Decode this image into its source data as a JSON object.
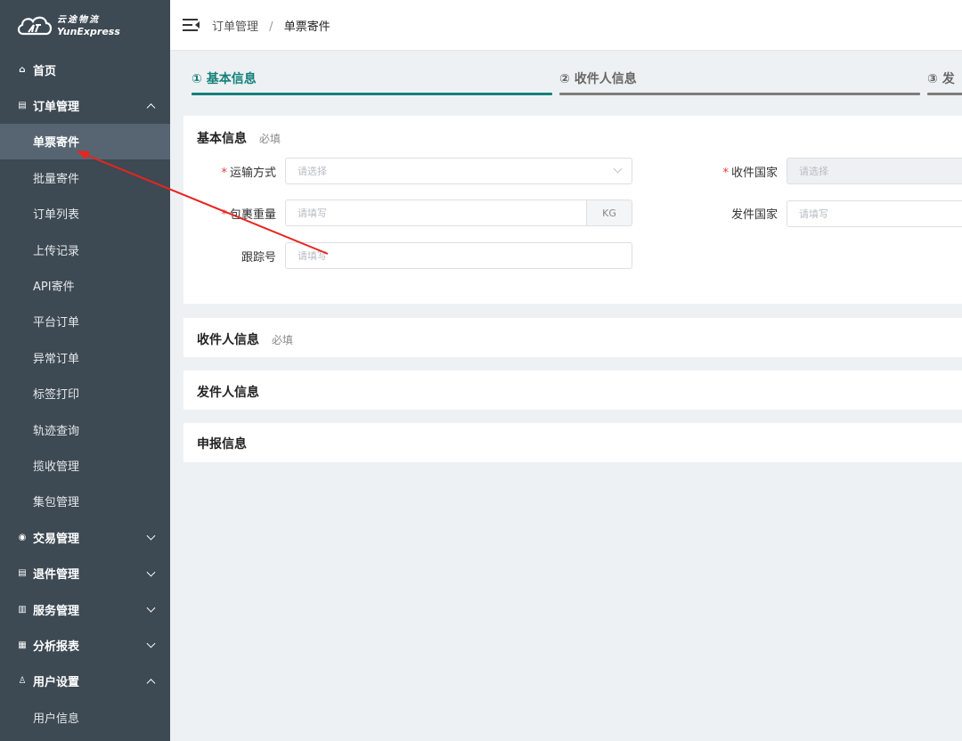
{
  "brand": {
    "cn": "云途物流",
    "en": "YunExpress"
  },
  "sidebar": {
    "items": [
      {
        "label": "首页",
        "level": "top",
        "icon": "home-icon",
        "glyph": "⌂"
      },
      {
        "label": "订单管理",
        "level": "top",
        "icon": "document-icon",
        "glyph": "▤",
        "caret": "up"
      },
      {
        "label": "单票寄件",
        "level": "sub",
        "active": true
      },
      {
        "label": "批量寄件",
        "level": "sub"
      },
      {
        "label": "订单列表",
        "level": "sub"
      },
      {
        "label": "上传记录",
        "level": "sub"
      },
      {
        "label": "API寄件",
        "level": "sub"
      },
      {
        "label": "平台订单",
        "level": "sub"
      },
      {
        "label": "异常订单",
        "level": "sub"
      },
      {
        "label": "标签打印",
        "level": "sub"
      },
      {
        "label": "轨迹查询",
        "level": "sub"
      },
      {
        "label": "揽收管理",
        "level": "sub"
      },
      {
        "label": "集包管理",
        "level": "sub"
      },
      {
        "label": "交易管理",
        "level": "top",
        "icon": "exchange-icon",
        "glyph": "◉",
        "caret": "down"
      },
      {
        "label": "退件管理",
        "level": "top",
        "icon": "document-icon",
        "glyph": "▤",
        "caret": "down"
      },
      {
        "label": "服务管理",
        "level": "top",
        "icon": "service-icon",
        "glyph": "▥",
        "caret": "down"
      },
      {
        "label": "分析报表",
        "level": "top",
        "icon": "chart-icon",
        "glyph": "▦",
        "caret": "down"
      },
      {
        "label": "用户设置",
        "level": "top",
        "icon": "user-icon",
        "glyph": "♙",
        "caret": "up"
      },
      {
        "label": "用户信息",
        "level": "sub"
      }
    ]
  },
  "topbar": {
    "crumb_parent": "订单管理",
    "crumb_sep": "/",
    "crumb_current": "单票寄件"
  },
  "steps": [
    {
      "label": "① 基本信息",
      "active": true
    },
    {
      "label": "② 收件人信息",
      "active": false
    },
    {
      "label": "③ 发",
      "active": false
    }
  ],
  "basic": {
    "title": "基本信息",
    "required": "必填",
    "transport_label": "运输方式",
    "transport_placeholder": "请选择",
    "dest_country_label": "收件国家",
    "dest_country_placeholder": "请选择",
    "weight_label": "包裹重量",
    "weight_placeholder": "请填写",
    "weight_unit": "KG",
    "origin_country_label": "发件国家",
    "origin_country_placeholder": "请填写",
    "tracking_label": "跟踪号",
    "tracking_placeholder": "请填写"
  },
  "recipient": {
    "title": "收件人信息",
    "required": "必填"
  },
  "sender": {
    "title": "发件人信息"
  },
  "declaration": {
    "title": "申报信息"
  },
  "colors": {
    "accent": "#13807a",
    "sidebar": "#3d4953",
    "active_item": "#566571",
    "annotation_arrow": "#e8251f"
  }
}
